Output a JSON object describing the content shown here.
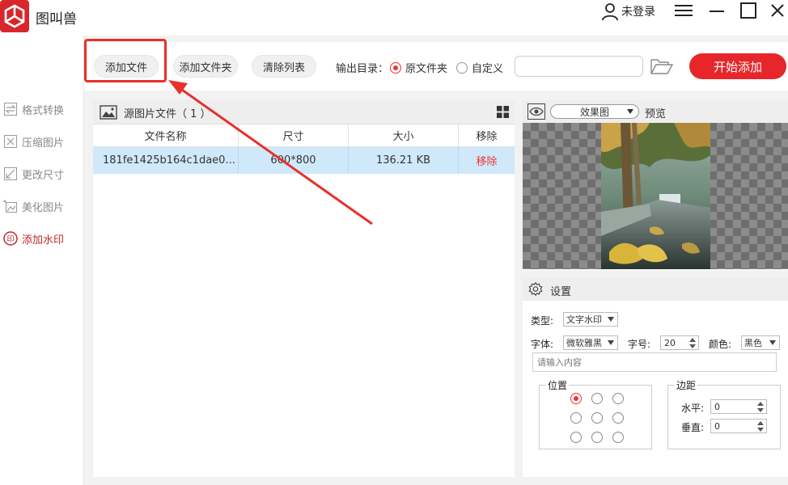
{
  "app": {
    "name": "图叫兽"
  },
  "user": {
    "label": "未登录"
  },
  "toolbar": {
    "add_file": "添加文件",
    "add_folder": "添加文件夹",
    "clear_list": "清除列表",
    "output_label": "输出目录：",
    "radio_original": "原文件夹",
    "radio_custom": "自定义",
    "output_path": "",
    "start": "开始添加"
  },
  "sidebar": {
    "items": [
      {
        "label": "格式转换",
        "icon": "format-convert-icon"
      },
      {
        "label": "压缩图片",
        "icon": "compress-icon"
      },
      {
        "label": "更改尺寸",
        "icon": "resize-icon"
      },
      {
        "label": "美化图片",
        "icon": "beautify-icon"
      },
      {
        "label": "添加水印",
        "icon": "watermark-icon",
        "active": true
      }
    ]
  },
  "files": {
    "title": "源图片文件（ 1 ）",
    "columns": [
      "文件名称",
      "尺寸",
      "大小",
      "移除"
    ],
    "rows": [
      {
        "name": "181fe1425b164c1dae0...",
        "size": "600*800",
        "filesize": "136.21 KB",
        "action": "移除"
      }
    ]
  },
  "preview": {
    "mode": "效果图",
    "label": "预览"
  },
  "settings": {
    "title": "设置",
    "type_label": "类型:",
    "type_value": "文字水印",
    "font_label": "字体:",
    "font_value": "微软雅黑",
    "fontsize_label": "字号:",
    "fontsize_value": "20",
    "color_label": "颜色:",
    "color_value": "黑色",
    "text_placeholder": "请输入内容",
    "position_title": "位置",
    "margin_title": "边距",
    "horizontal_label": "水平:",
    "horizontal_value": "0",
    "vertical_label": "垂直:",
    "vertical_value": "0"
  },
  "colors": {
    "accent": "#e6262a",
    "selected_row": "#cfe9fb"
  }
}
